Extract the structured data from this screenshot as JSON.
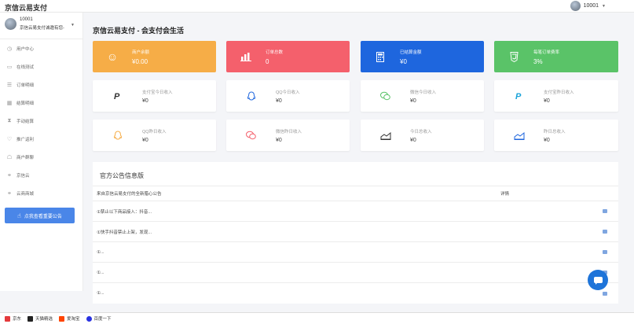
{
  "header": {
    "brand": "京信云易支付",
    "user": "10001"
  },
  "sidebar": {
    "user_id": "10001",
    "user_sub": "京信云易支付诚邀有您-",
    "items": [
      {
        "label": "用户中心",
        "icon": "clock-icon"
      },
      {
        "label": "在线测试",
        "icon": "laptop-icon"
      },
      {
        "label": "订单明细",
        "icon": "list-icon"
      },
      {
        "label": "结算明细",
        "icon": "calculator-icon"
      },
      {
        "label": "手动结算",
        "icon": "hourglass-icon"
      },
      {
        "label": "推广返利",
        "icon": "gift-icon"
      },
      {
        "label": "商户群聊",
        "icon": "qq-icon"
      },
      {
        "label": "京信云",
        "icon": "link-icon"
      },
      {
        "label": "云商商城",
        "icon": "link-icon"
      }
    ],
    "notice_button": "点我查看重要公告"
  },
  "main": {
    "title": "京信云易支付 - 会支付会生活",
    "stats": [
      {
        "label": "商户余额",
        "value": "¥0.00",
        "color": "#f6ad47",
        "icon": "smile-icon"
      },
      {
        "label": "订单总数",
        "value": "0",
        "color": "#f4606c",
        "icon": "bar-chart-icon"
      },
      {
        "label": "已结算金额",
        "value": "¥0",
        "color": "#1e66de",
        "icon": "calculator-icon"
      },
      {
        "label": "每笔订单费率",
        "value": "3%",
        "color": "#5ac368",
        "icon": "css-icon"
      }
    ],
    "cards": [
      {
        "label": "支付宝今日收入",
        "value": "¥0",
        "icon": "paypal-icon",
        "color": "#333"
      },
      {
        "label": "QQ今日收入",
        "value": "¥0",
        "icon": "qq-icon",
        "color": "#1e66de"
      },
      {
        "label": "微信今日收入",
        "value": "¥0",
        "icon": "wechat-icon",
        "color": "#5ac368"
      },
      {
        "label": "支付宝昨日收入",
        "value": "¥0",
        "icon": "paypal-icon",
        "color": "#1aa3d9"
      },
      {
        "label": "QQ昨日收入",
        "value": "¥0",
        "icon": "qq-icon",
        "color": "#f6ad47"
      },
      {
        "label": "微信昨日收入",
        "value": "¥0",
        "icon": "wechat-icon",
        "color": "#f4606c"
      },
      {
        "label": "今日总收入",
        "value": "¥0",
        "icon": "area-chart-icon",
        "color": "#333"
      },
      {
        "label": "昨日总收入",
        "value": "¥0",
        "icon": "area-chart-icon",
        "color": "#1e66de"
      }
    ],
    "announcements": {
      "title": "官方公告信息版",
      "col_title": "来自京信云易支付的全新腊心公告",
      "col_detail": "详情",
      "rows": [
        "①禁止以下商品接入：抖音...",
        "①快手抖音禁止上架，发现...",
        "①...",
        "①...",
        "①..."
      ]
    }
  },
  "bookmarks": [
    "京东",
    "天猫精选",
    "爱淘宝",
    "百度一下"
  ]
}
